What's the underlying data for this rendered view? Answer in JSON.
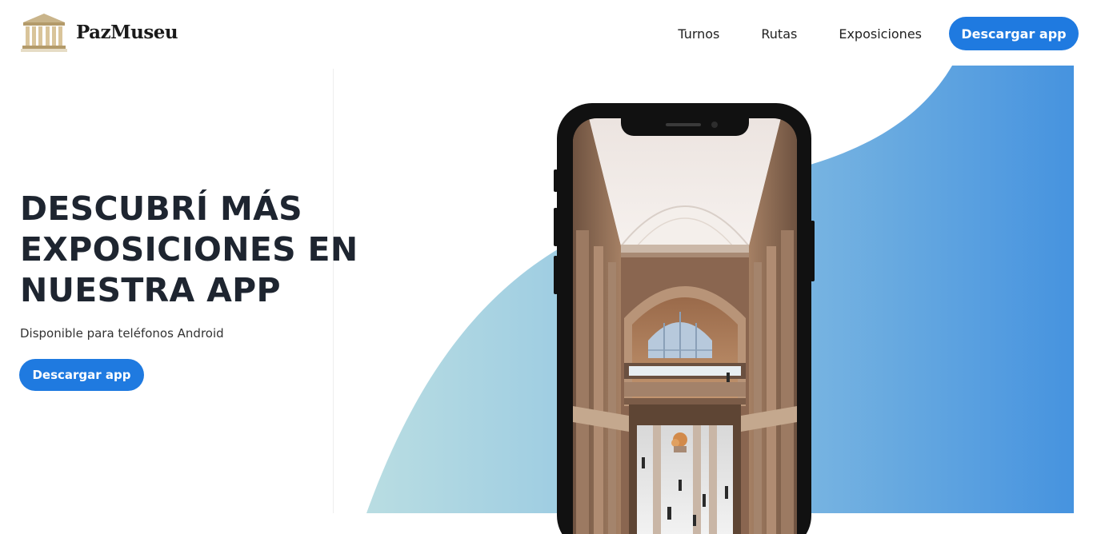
{
  "brand": {
    "name": "PazMuseu",
    "logo_icon": "museum-building-icon"
  },
  "nav": {
    "links": [
      "Turnos",
      "Rutas",
      "Exposiciones"
    ],
    "cta_label": "Descargar app"
  },
  "hero": {
    "title_lines": [
      "DESCUBRÍ MÁS",
      "EXPOSICIONES EN",
      "NUESTRA APP"
    ],
    "subtitle": "Disponible para teléfonos Android",
    "cta_label": "Descargar app"
  },
  "colors": {
    "primary": "#1f7ae0",
    "wave_start": "#b6dbe3",
    "wave_end": "#4a96df",
    "heading": "#1e2530"
  },
  "phone_image": "museum-interior-photo"
}
